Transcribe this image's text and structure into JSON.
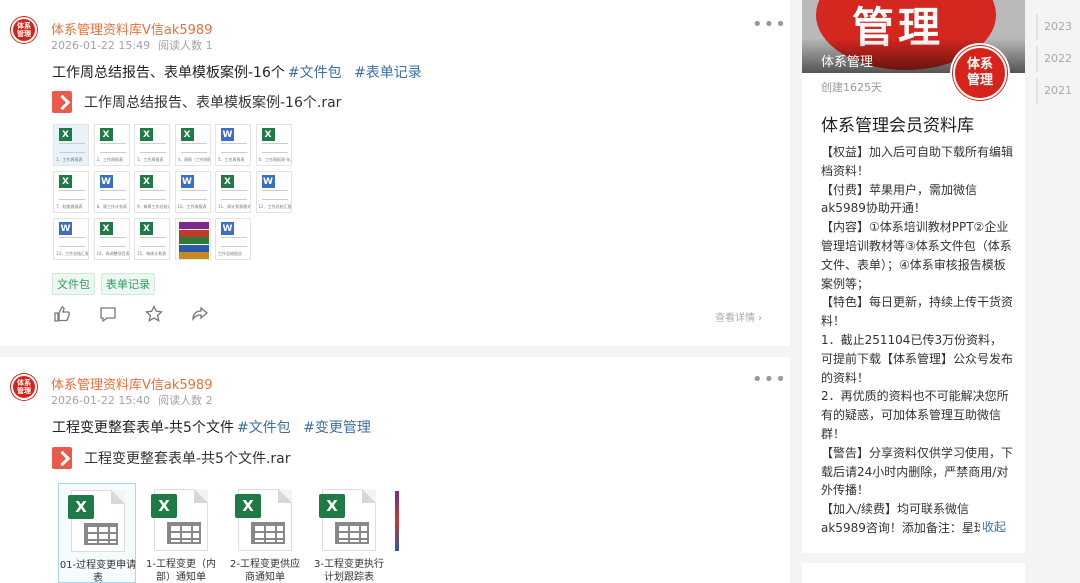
{
  "post1": {
    "author": "体系管理资料库V信ak5989",
    "avatar_text": "体系管理",
    "time": "2026-01-22 15:49",
    "reads": "阅读人数 1",
    "title": "工作周总结报告、表单模板案例-16个",
    "tags": [
      "#文件包",
      "#表单记录"
    ],
    "attachment": "工作周总结报告、表单模板案例-16个.rar",
    "thumbnails": [
      {
        "type": "x",
        "caption": "1、工作周报表"
      },
      {
        "type": "x",
        "caption": "2、工作周报表"
      },
      {
        "type": "x",
        "caption": "3、工作周报表"
      },
      {
        "type": "x",
        "caption": "4、周报（工作周报表"
      },
      {
        "type": "w",
        "caption": "5、工作周报表"
      },
      {
        "type": "x",
        "caption": "6、工作周报表-年度工作周报表"
      },
      {
        "type": "x",
        "caption": "7、制度周报表"
      },
      {
        "type": "w",
        "caption": "8、周工作计划表"
      },
      {
        "type": "x",
        "caption": "9、每周工作总结计划"
      },
      {
        "type": "w",
        "caption": "10、工作周报表"
      },
      {
        "type": "x",
        "caption": "11、周计划表格式周报周工作情况"
      },
      {
        "type": "w",
        "caption": "12、工作总结汇报表"
      },
      {
        "type": "w",
        "caption": "13、工作总结汇报表"
      },
      {
        "type": "x",
        "caption": "14、周调整项目表"
      },
      {
        "type": "x",
        "caption": "15、每周计划表（新"
      },
      {
        "type": "rar",
        "caption": "工作总结报告"
      },
      {
        "type": "w",
        "caption": "工作总结报告"
      }
    ],
    "chips": [
      "文件包",
      "表单记录"
    ],
    "detail": "查看详情"
  },
  "post2": {
    "author": "体系管理资料库V信ak5989",
    "avatar_text": "体系管理",
    "time": "2026-01-22 15:40",
    "reads": "阅读人数 2",
    "title": "工程变更整套表单-共5个文件",
    "tags": [
      "#文件包",
      "#变更管理"
    ],
    "attachment": "工程变更整套表单-共5个文件.rar",
    "files": [
      {
        "line1": "01-过程变更申请",
        "line2": "表"
      },
      {
        "line1": "1-工程变更（内",
        "line2": "部）通知单"
      },
      {
        "line1": "2-工程变更供应",
        "line2": "商通知单"
      },
      {
        "line1": "3-工程变更执行",
        "line2": "计划跟踪表"
      }
    ]
  },
  "sidebar": {
    "banner_text": "管理",
    "banner_name": "体系管理",
    "logo_text": "体系管理",
    "created": "创建1625天",
    "name": "体系管理会员资料库",
    "paragraphs": [
      "【权益】加入后可自助下载所有编辑档资料！",
      "【付费】苹果用户，需加微信ak5989协助开通！",
      "【内容】①体系培训教材PPT②企业管理培训教材等③体系文件包（体系文件、表单）；④体系审核报告模板案例等；",
      "【特色】每日更新，持续上传干货资料！",
      "1．截止251104已传3万份资料，可提前下载【体系管理】公众号发布的资料！",
      "2．再优质的资料也不可能解决您所有的疑惑，可加体系管理互助微信群！",
      "【警告】分享资料仅供学习使用，下载后请24小时内删除，严禁商用/对外传播！",
      "【加入/续费】均可联系微信ak5989咨询！添加备注：星球"
    ],
    "fold": "收起"
  },
  "years": [
    "2023",
    "2022",
    "2021"
  ],
  "colors": {
    "brand_red": "#d8231a",
    "author": "#e8703a",
    "tag": "#3e6fa3",
    "chip": "#2f9a63"
  }
}
